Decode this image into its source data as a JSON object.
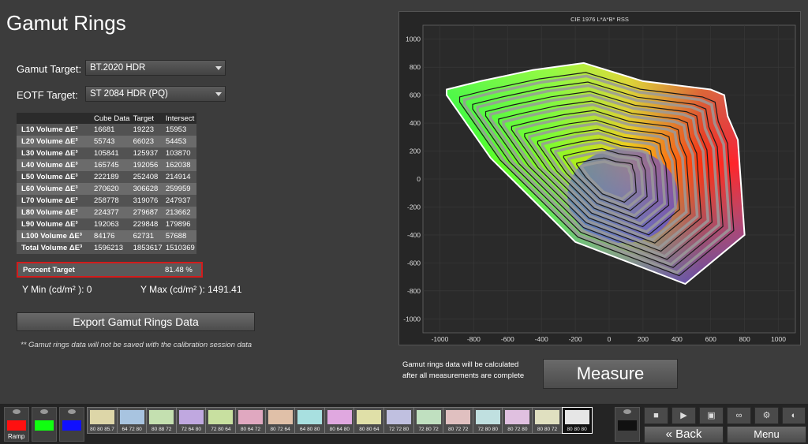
{
  "page": {
    "title": "Gamut Rings"
  },
  "form": {
    "gamut_label": "Gamut Target:",
    "gamut_value": "BT.2020 HDR",
    "eotf_label": "EOTF Target:",
    "eotf_value": "ST 2084 HDR (PQ)"
  },
  "table": {
    "headers": [
      "",
      "Cube Data",
      "Target",
      "Intersect"
    ],
    "rows": [
      {
        "name": "L10 Volume ΔE³",
        "cube": "16681",
        "target": "19223",
        "intersect": "15953"
      },
      {
        "name": "L20 Volume ΔE³",
        "cube": "55743",
        "target": "66023",
        "intersect": "54453"
      },
      {
        "name": "L30 Volume ΔE³",
        "cube": "105841",
        "target": "125937",
        "intersect": "103870"
      },
      {
        "name": "L40 Volume ΔE³",
        "cube": "165745",
        "target": "192056",
        "intersect": "162038"
      },
      {
        "name": "L50 Volume ΔE³",
        "cube": "222189",
        "target": "252408",
        "intersect": "214914"
      },
      {
        "name": "L60 Volume ΔE³",
        "cube": "270620",
        "target": "306628",
        "intersect": "259959"
      },
      {
        "name": "L70 Volume ΔE³",
        "cube": "258778",
        "target": "319076",
        "intersect": "247937"
      },
      {
        "name": "L80 Volume ΔE³",
        "cube": "224377",
        "target": "279687",
        "intersect": "213662"
      },
      {
        "name": "L90 Volume ΔE³",
        "cube": "192063",
        "target": "229848",
        "intersect": "179896"
      },
      {
        "name": "L100 Volume ΔE³",
        "cube": "84176",
        "target": "62731",
        "intersect": "57688"
      },
      {
        "name": "Total Volume ΔE³",
        "cube": "1596213",
        "target": "1853617",
        "intersect": "1510369"
      }
    ],
    "percent_label": "Percent Target",
    "percent_value": "81.48 %"
  },
  "stats": {
    "ymin": "Y Min (cd/m² ): 0",
    "ymax": "Y Max (cd/m² ): 1491.41"
  },
  "export_button": "Export Gamut Rings Data",
  "note": "** Gamut rings data will not be saved with the calibration session data",
  "calc_note_1": "Gamut rings data will be calculated",
  "calc_note_2": "after all measurements are complete",
  "measure_button": "Measure",
  "chart_data": {
    "type": "scatter",
    "title": "CIE 1976 L*A*B* RSS",
    "xlim": [
      -1100,
      1100
    ],
    "ylim": [
      -1100,
      1100
    ],
    "xticks": [
      -1000,
      -800,
      -600,
      -400,
      -200,
      0,
      200,
      400,
      600,
      800,
      1000
    ],
    "yticks": [
      1000,
      800,
      600,
      400,
      200,
      0,
      -200,
      -400,
      -600,
      -800,
      -1000
    ],
    "target_outline": [
      [
        -960,
        640
      ],
      [
        -760,
        700
      ],
      [
        -450,
        780
      ],
      [
        -150,
        830
      ],
      [
        200,
        700
      ],
      [
        600,
        640
      ],
      [
        680,
        600
      ],
      [
        700,
        450
      ],
      [
        760,
        280
      ],
      [
        800,
        -400
      ],
      [
        450,
        -750
      ],
      [
        -200,
        -450
      ],
      [
        -700,
        150
      ],
      [
        -960,
        600
      ]
    ],
    "ring_scales": [
      1.0,
      0.92,
      0.84,
      0.76,
      0.68,
      0.6,
      0.52,
      0.44,
      0.36,
      0.28,
      0.2
    ],
    "ring_center": [
      0,
      -20
    ]
  },
  "toolbar": {
    "ramp_label": "Ramp",
    "ramp_colors": [
      "#ff1010",
      "#10ff10",
      "#1010ff"
    ],
    "swatches": [
      {
        "label": "80 80 85.7",
        "color": "#ddd6a8"
      },
      {
        "label": "64 72 80",
        "color": "#a8c4e0"
      },
      {
        "label": "80 88 72",
        "color": "#c4e0b0"
      },
      {
        "label": "72 64 80",
        "color": "#c0a8e0"
      },
      {
        "label": "72 80 64",
        "color": "#c8e0a0"
      },
      {
        "label": "80 64 72",
        "color": "#e0a8c0"
      },
      {
        "label": "80 72 64",
        "color": "#e0c0a8"
      },
      {
        "label": "64 80 80",
        "color": "#a8e0e0"
      },
      {
        "label": "80 64 80",
        "color": "#e0a8e0"
      },
      {
        "label": "80 80 64",
        "color": "#e0e0a8"
      },
      {
        "label": "72 72 80",
        "color": "#c0c0e0"
      },
      {
        "label": "72 80 72",
        "color": "#c0e0c0"
      },
      {
        "label": "80 72 72",
        "color": "#e0c0c0"
      },
      {
        "label": "72 80 80",
        "color": "#c0e0e0"
      },
      {
        "label": "80 72 80",
        "color": "#e0c0e0"
      },
      {
        "label": "80 80 72",
        "color": "#e0e0c0"
      },
      {
        "label": "80 80 80",
        "color": "#e6e6e6"
      }
    ],
    "back_label": "Back",
    "menu_label": "Menu"
  }
}
